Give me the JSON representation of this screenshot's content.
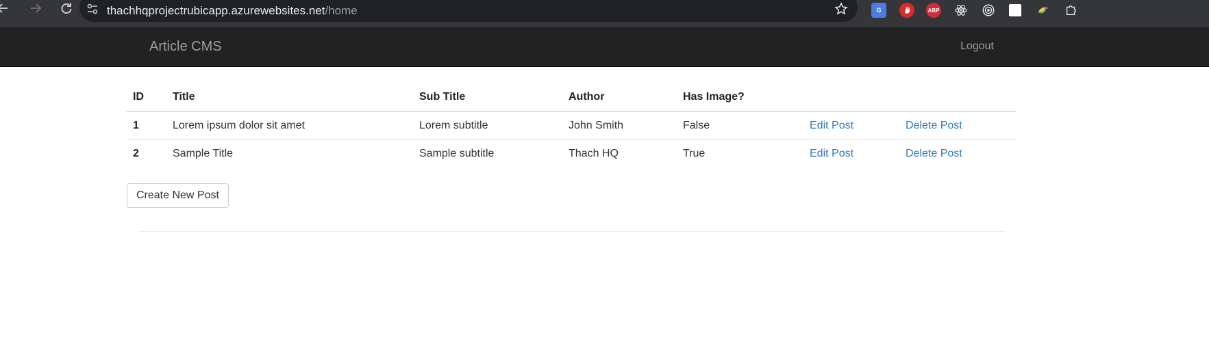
{
  "browser": {
    "url_host": "thachhqprojectrubicapp.azurewebsites.net",
    "url_path": "/home",
    "extensions": [
      "translate-icon",
      "hand-icon",
      "adblock-icon",
      "react-icon",
      "radio-icon",
      "white-square-icon",
      "color-icon",
      "puzzle-icon"
    ],
    "abp_label": "ABP"
  },
  "navbar": {
    "brand": "Article CMS",
    "logout": "Logout"
  },
  "table": {
    "headers": [
      "ID",
      "Title",
      "Sub Title",
      "Author",
      "Has Image?",
      "",
      ""
    ],
    "rows": [
      {
        "id": "1",
        "title": "Lorem ipsum dolor sit amet",
        "subtitle": "Lorem subtitle",
        "author": "John Smith",
        "has_image": "False",
        "edit": "Edit Post",
        "delete": "Delete Post"
      },
      {
        "id": "2",
        "title": "Sample Title",
        "subtitle": "Sample subtitle",
        "author": "Thach HQ",
        "has_image": "True",
        "edit": "Edit Post",
        "delete": "Delete Post"
      }
    ]
  },
  "actions": {
    "create_label": "Create New Post"
  },
  "colors": {
    "navbar_bg": "#222222",
    "link": "#337ab7",
    "chrome_bg": "#35363a"
  }
}
